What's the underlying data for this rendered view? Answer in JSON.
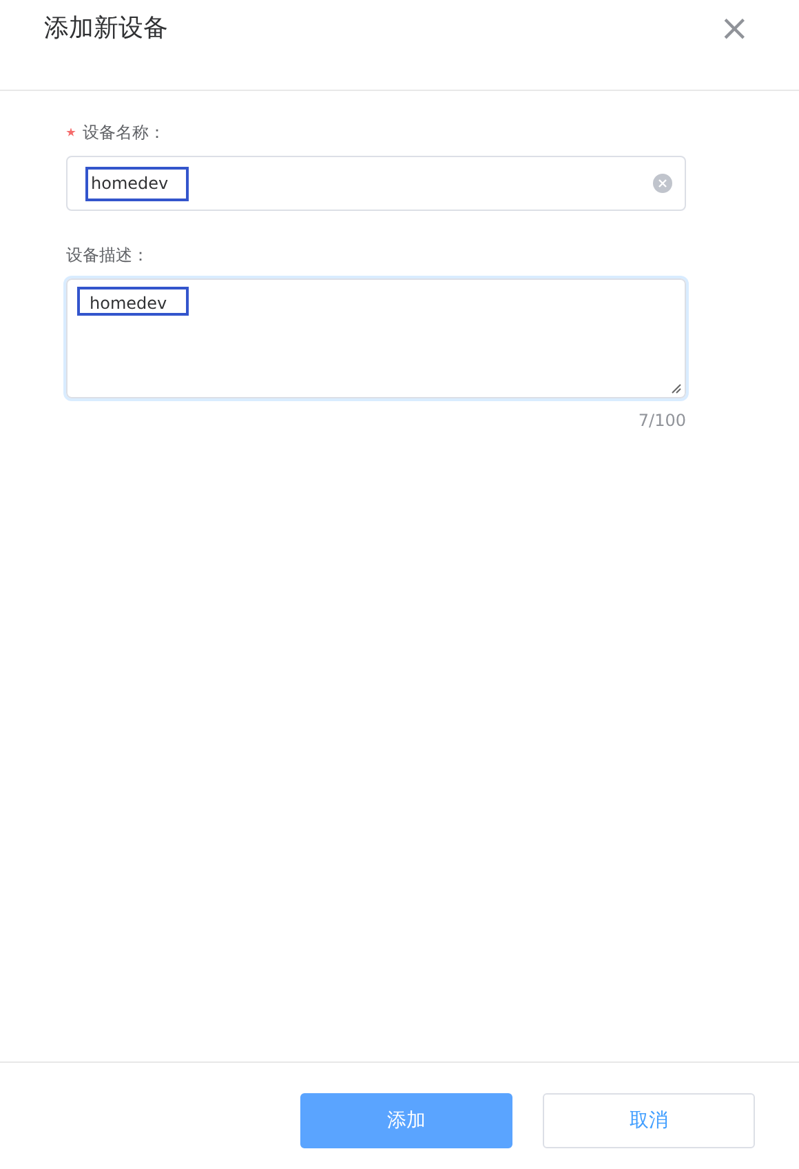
{
  "drawer": {
    "title": "添加新设备",
    "close_icon": "×"
  },
  "fields": [
    {
      "kind": "input",
      "label": "设备名称：",
      "required": true,
      "value": "homedev",
      "clearable": true,
      "focused": false,
      "highlighted": true
    },
    {
      "kind": "textarea",
      "label": "设备描述：",
      "required": false,
      "value": "homedev",
      "counter": "7/100",
      "focused": true,
      "highlighted": true
    }
  ],
  "buttons": [
    {
      "label": "添加",
      "kind": "primary"
    },
    {
      "label": "取消",
      "kind": "default"
    }
  ]
}
